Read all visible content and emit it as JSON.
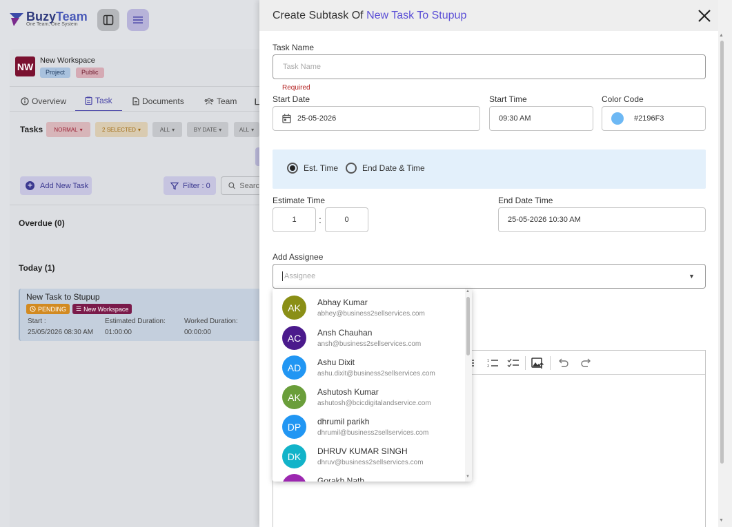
{
  "app": {
    "brand_a": "Buzy",
    "brand_b": "Team",
    "tagline": "One Team, One System"
  },
  "workspace": {
    "initials": "NW",
    "name": "New Workspace",
    "tags": [
      "Project",
      "Public"
    ],
    "tabs": [
      "Overview",
      "Task",
      "Documents",
      "Team"
    ],
    "tasks_label": "Tasks",
    "filters": [
      "NORMAL",
      "2 SELECTED",
      "ALL",
      "BY DATE",
      "ALL"
    ],
    "add_task_label": "Add New Task",
    "filter_label": "Filter : 0",
    "search_placeholder": "Searc",
    "sections": {
      "overdue": "Overdue (0)",
      "today": "Today (1)"
    },
    "task": {
      "title": "New Task to Stupup",
      "status": "PENDING",
      "workspace": "New Workspace",
      "start_label": "Start :",
      "start_value": "25/05/2026 08:30 AM",
      "est_label": "Estimated Duration:",
      "est_value": "01:00:00",
      "worked_label": "Worked Duration:",
      "worked_value": "00:00:00"
    }
  },
  "drawer": {
    "title_prefix": "Create Subtask Of ",
    "title_parent": "New Task To Stupup",
    "task_name_label": "Task Name",
    "task_name_placeholder": "Task Name",
    "task_name_error": "Required",
    "start_date_label": "Start Date",
    "start_date_value": "25-05-2026",
    "start_time_label": "Start Time",
    "start_time_value": "09:30 AM",
    "color_code_label": "Color Code",
    "color_code_value": "#2196F3",
    "color_swatch": "#6db8f4",
    "radio_est": "Est. Time",
    "radio_end": "End Date & Time",
    "estimate_label": "Estimate Time",
    "estimate_hours": "1",
    "estimate_minutes": "0",
    "end_dt_label": "End Date Time",
    "end_dt_value": "25-05-2026 10:30 AM",
    "assignee_label": "Add Assignee",
    "assignee_placeholder": "Assignee"
  },
  "assignees": [
    {
      "initials": "AK",
      "name": "Abhay Kumar",
      "email": "abhey@business2sellservices.com",
      "color": "#8a8f16"
    },
    {
      "initials": "AC",
      "name": "Ansh Chauhan",
      "email": "ansh@business2sellservices.com",
      "color": "#4b1a8c"
    },
    {
      "initials": "AD",
      "name": "Ashu Dixit",
      "email": "ashu.dixit@business2sellservices.com",
      "color": "#2196f3"
    },
    {
      "initials": "AK",
      "name": "Ashutosh Kumar",
      "email": "ashutosh@bcicdigitalandservice.com",
      "color": "#6a9e3a"
    },
    {
      "initials": "DP",
      "name": "dhrumil parikh",
      "email": "dhrumil@business2sellservices.com",
      "color": "#2196f3"
    },
    {
      "initials": "DK",
      "name": "DHRUV KUMAR SINGH",
      "email": "dhruv@business2sellservices.com",
      "color": "#12b3c9"
    },
    {
      "initials": "",
      "name": "Gorakh Nath",
      "email": "",
      "color": "#9c27b0"
    }
  ]
}
